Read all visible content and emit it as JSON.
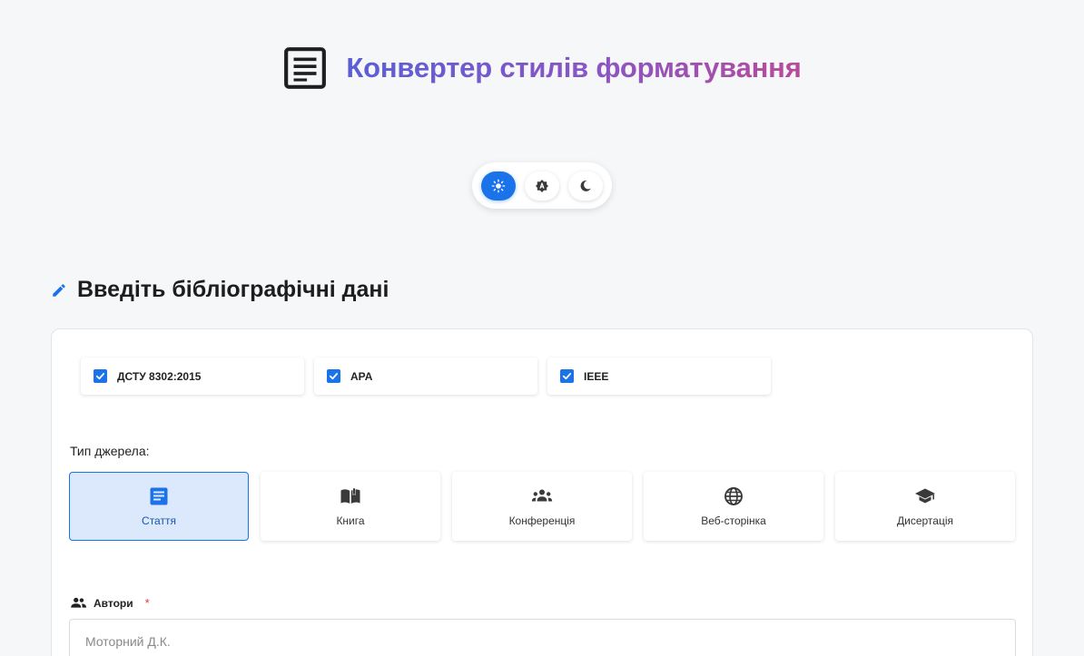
{
  "header": {
    "title": "Конвертер стилів форматування",
    "logo_icon": "article-icon"
  },
  "theme_switcher": {
    "options": [
      {
        "name": "light",
        "icon": "sun-icon",
        "active": true
      },
      {
        "name": "auto",
        "icon": "brightness-auto-icon",
        "active": false
      },
      {
        "name": "dark",
        "icon": "moon-icon",
        "active": false
      }
    ]
  },
  "section": {
    "title": "Введіть бібліографічні дані",
    "icon": "pencil-icon"
  },
  "styles": [
    {
      "label": "ДСТУ 8302:2015",
      "checked": true
    },
    {
      "label": "APA",
      "checked": true
    },
    {
      "label": "IEEE",
      "checked": true
    }
  ],
  "source_type": {
    "label": "Тип джерела:",
    "options": [
      {
        "label": "Стаття",
        "icon": "article-icon",
        "active": true
      },
      {
        "label": "Книга",
        "icon": "book-icon",
        "active": false
      },
      {
        "label": "Конференція",
        "icon": "groups-icon",
        "active": false
      },
      {
        "label": "Веб-сторінка",
        "icon": "globe-icon",
        "active": false
      },
      {
        "label": "Дисертація",
        "icon": "graduation-cap-icon",
        "active": false
      }
    ]
  },
  "authors": {
    "label": "Автори",
    "required_mark": "*",
    "placeholder": "Моторний Д.К.",
    "value": ""
  },
  "colors": {
    "accent": "#1a73e8",
    "title_gradient_start": "#5a5fd6",
    "title_gradient_end": "#b84a9a",
    "required": "#e53935"
  }
}
